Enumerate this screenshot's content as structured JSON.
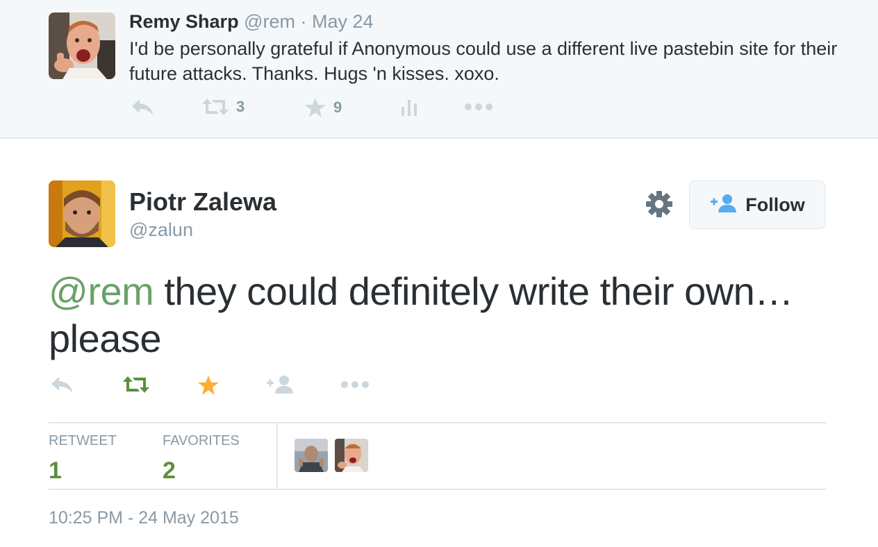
{
  "parent_tweet": {
    "author_name": "Remy Sharp",
    "author_handle": "@rem",
    "separator": "·",
    "date": "May 24",
    "text": "I'd be personally grateful if Anonymous could use a different live pastebin site for their future attacks. Thanks. Hugs 'n kisses. xoxo.",
    "retweet_count": "3",
    "favorite_count": "9",
    "icons": [
      "reply-icon",
      "retweet-icon",
      "star-icon",
      "analytics-icon",
      "more-icon"
    ]
  },
  "main_tweet": {
    "author_name": "Piotr Zalewa",
    "author_handle": "@zalun",
    "follow_label": "Follow",
    "text_mention": "@rem",
    "text_body": " they could definitely write their own… please",
    "icons": [
      "reply-icon",
      "retweet-icon",
      "star-icon",
      "follow-icon",
      "more-icon"
    ],
    "stats": {
      "retweet_label": "RETWEET",
      "retweet_value": "1",
      "favorites_label": "FAVORITES",
      "favorites_value": "2"
    },
    "timestamp": "10:25 PM - 24 May 2015"
  },
  "colors": {
    "retweeted": "#5a8f3e",
    "favorited": "#ffac33",
    "mention": "#6aa167",
    "muted": "#8899a6",
    "follow_icon": "#55acee"
  }
}
